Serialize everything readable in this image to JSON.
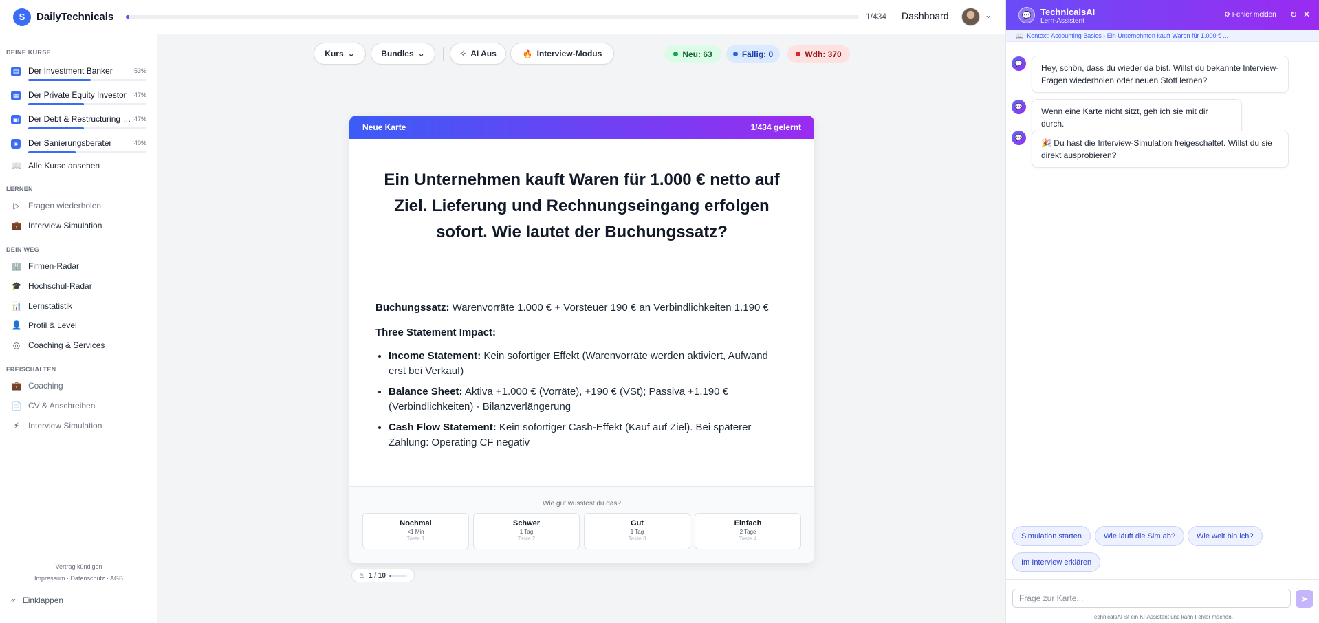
{
  "app": {
    "logo_letter": "S",
    "name": "DailyTechnicals"
  },
  "header": {
    "progress_fraction": 0.0023,
    "progress_label": "1/434",
    "dashboard_link": "Dashboard",
    "avatar_icon": "user-avatar",
    "menu_icon": "chevron-down-icon"
  },
  "sidebar": {
    "section_courses": "DEINE KURSE",
    "courses": [
      {
        "name": "Der Investment Banker",
        "percent": "53%",
        "progress": 0.53
      },
      {
        "name": "Der Private Equity Investor",
        "percent": "47%",
        "progress": 0.47
      },
      {
        "name": "Der Debt & Restructuring Specialist",
        "percent": "47%",
        "progress": 0.47
      },
      {
        "name": "Der Sanierungsberater",
        "percent": "40%",
        "progress": 0.4
      }
    ],
    "all_courses": "Alle Kurse ansehen",
    "section_learn": "LERNEN",
    "learn_items": [
      "Fragen wiederholen",
      "Interview Simulation"
    ],
    "section_path": "DEIN WEG",
    "path_items": [
      "Firmen-Radar",
      "Hochschul-Radar",
      "Lernstatistik",
      "Profil & Level",
      "Coaching & Services"
    ],
    "section_unlock": "FREISCHALTEN",
    "unlock_items": [
      "Coaching",
      "CV & Anschreiben",
      "Interview Simulation"
    ],
    "cancel_contract": "Vertrag kündigen",
    "imprint": "Impressum",
    "privacy": "Datenschutz",
    "terms": "AGB",
    "link_separator": "·",
    "collapse": "Einklappen"
  },
  "toolbar": {
    "course": "Kurs",
    "bundles": "Bundles",
    "ai": "AI Aus",
    "interview": "Interview-Modus",
    "stat_new": "Neu: 63",
    "stat_due": "Fällig: 0",
    "stat_repeat": "Wdh: 370",
    "colors": {
      "new": "#16a34a",
      "due": "#2563eb",
      "repeat": "#dc2626"
    }
  },
  "card": {
    "badge": "Neue Karte",
    "learned": "1/434 gelernt",
    "question": "Ein Unternehmen kauft Waren für 1.000 € netto auf Ziel. Lieferung und Rechnungseingang erfolgen sofort. Wie lautet der Buchungssatz?",
    "answer_label": "Buchungssatz:",
    "answer_text": " Warenvorräte 1.000 € + Vorsteuer 190 € an Verbindlichkeiten 1.190 €",
    "impact_title": "Three Statement Impact:",
    "impacts": [
      {
        "label": "Income Statement:",
        "text": " Kein sofortiger Effekt (Warenvorräte werden aktiviert, Aufwand erst bei Verkauf)"
      },
      {
        "label": "Balance Sheet:",
        "text": " Aktiva +1.000 € (Vorräte), +190 € (VSt); Passiva +1.190 € (Verbindlichkeiten) - Bilanzverlängerung"
      },
      {
        "label": "Cash Flow Statement:",
        "text": " Kein sofortiger Cash-Effekt (Kauf auf Ziel). Bei späterer Zahlung: Operating CF negativ"
      }
    ],
    "rating_question": "Wie gut wusstest du das?",
    "ratings": [
      {
        "label": "Nochmal",
        "interval": "<1 Min",
        "key": "Taste 1"
      },
      {
        "label": "Schwer",
        "interval": "1 Tag",
        "key": "Taste 2"
      },
      {
        "label": "Gut",
        "interval": "1 Tag",
        "key": "Taste 3"
      },
      {
        "label": "Einfach",
        "interval": "2 Tage",
        "key": "Taste 4"
      }
    ],
    "session_label": "1 / 10",
    "session_progress": 0.1
  },
  "chat": {
    "title": "TechnicalsAI",
    "subtitle": "Lern-Assistent",
    "report": "Fehler melden",
    "context": "Kontext: Accounting Basics › Ein Unternehmen kauft Waren für 1.000 € ...",
    "messages": [
      "Hey, schön, dass du wieder da bist. Willst du bekannte Interview-Fragen wiederholen oder neuen Stoff lernen?",
      "Wenn eine Karte nicht sitzt, geh ich sie mit dir durch.",
      "🎉 Du hast die Interview-Simulation freigeschaltet. Willst du sie direkt ausprobieren?"
    ],
    "chips": [
      "Simulation starten",
      "Wie läuft die Sim ab?",
      "Wie weit bin ich?",
      "Im Interview erklären"
    ],
    "input_placeholder": "Frage zur Karte...",
    "disclaimer": "TechnicalsAI ist ein KI-Assistent und kann Fehler machen."
  }
}
